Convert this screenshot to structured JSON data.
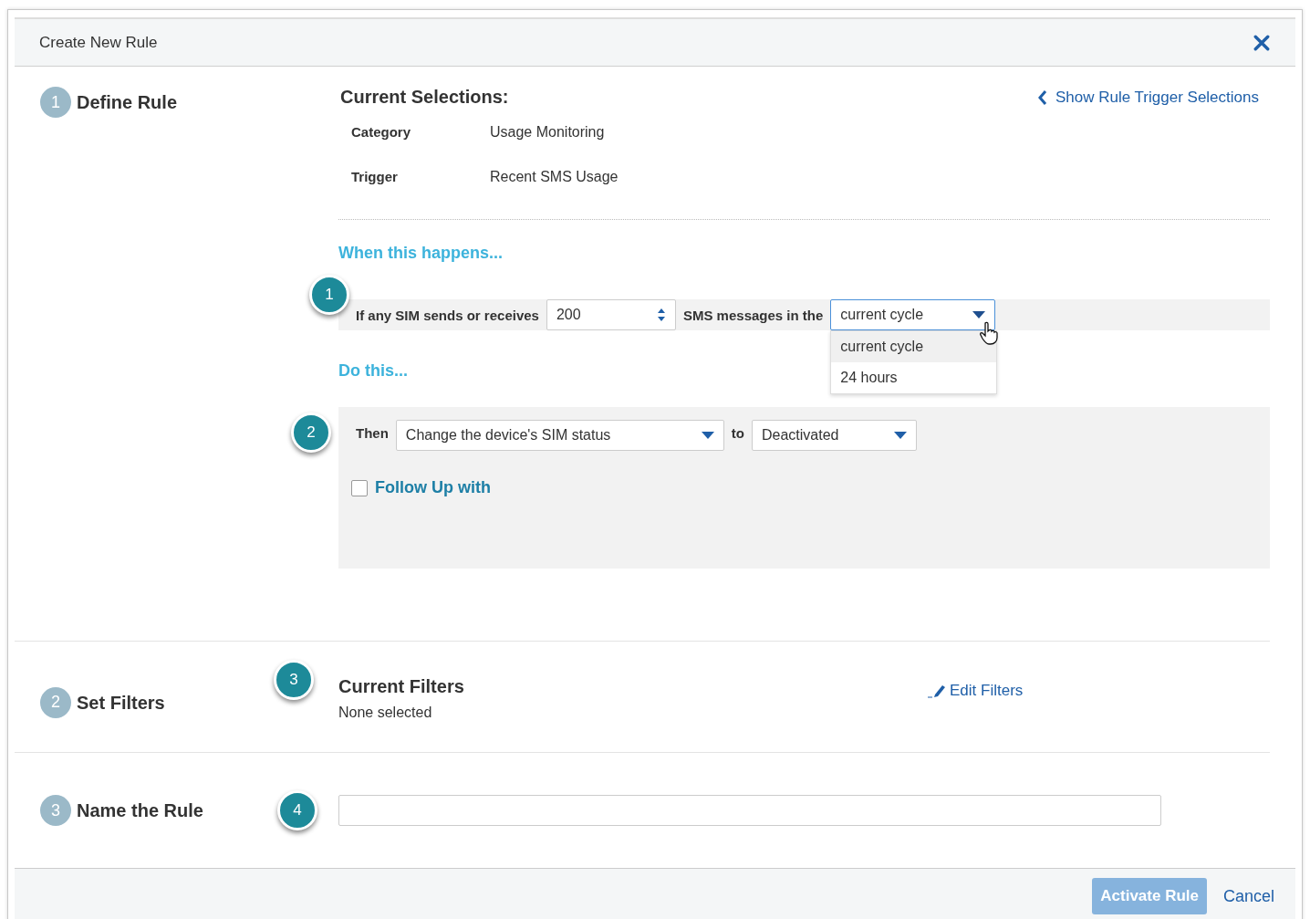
{
  "dialog": {
    "title": "Create New Rule"
  },
  "steps": [
    {
      "number": "1",
      "label": "Define Rule"
    },
    {
      "number": "2",
      "label": "Set Filters"
    },
    {
      "number": "3",
      "label": "Name the Rule"
    }
  ],
  "selections": {
    "heading": "Current Selections:",
    "toggle_link": "Show Rule Trigger Selections",
    "rows": [
      {
        "label": "Category",
        "value": "Usage Monitoring"
      },
      {
        "label": "Trigger",
        "value": "Recent SMS Usage"
      }
    ]
  },
  "condition": {
    "heading": "When this happens...",
    "prefix": "If any SIM sends or receives",
    "count": "200",
    "middle": "SMS messages in the",
    "period": {
      "value": "current cycle",
      "expanded": true,
      "options": [
        {
          "label": "current cycle",
          "selected": true
        },
        {
          "label": "24 hours",
          "selected": false
        }
      ]
    }
  },
  "action": {
    "heading": "Do this...",
    "then": "Then",
    "action_select": "Change the device's SIM status",
    "to": "to",
    "status_select": "Deactivated",
    "follow_up": {
      "label": "Follow Up with",
      "checked": false
    }
  },
  "filters": {
    "heading": "Current Filters",
    "value": "None selected",
    "edit_link": "Edit Filters"
  },
  "callouts": [
    "1",
    "2",
    "3",
    "4"
  ],
  "footer": {
    "primary": {
      "label": "Activate Rule",
      "disabled": true
    },
    "cancel": "Cancel"
  }
}
